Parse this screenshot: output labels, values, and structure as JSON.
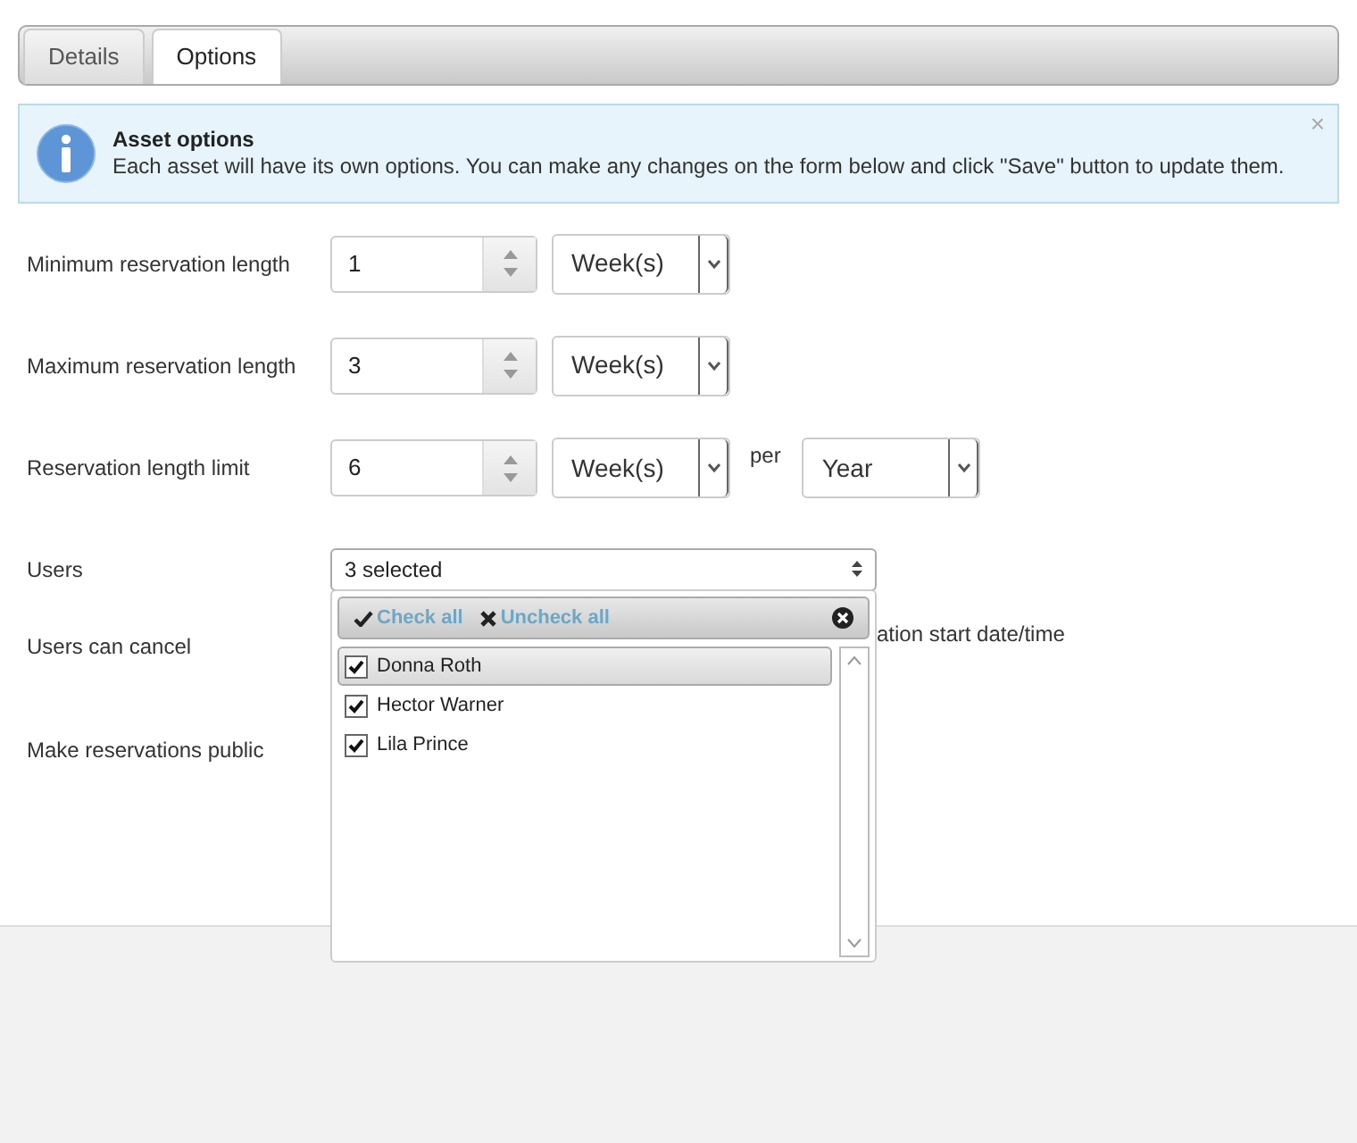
{
  "tabs": [
    {
      "label": "Details",
      "selected": false
    },
    {
      "label": "Options",
      "selected": true
    }
  ],
  "alert": {
    "title": "Asset options",
    "text": "Each asset will have its own options. You can make any changes on the form below and click \"Save\" button to update them.",
    "close": "×"
  },
  "rows": [
    {
      "kind": "spinner",
      "label": "Minimum reservation length",
      "value": "1",
      "unit": "Week(s)"
    },
    {
      "kind": "spinner",
      "label": "Maximum reservation length",
      "value": "3",
      "unit": "Week(s)"
    },
    {
      "kind": "spinner",
      "label": "Reservation length limit",
      "value": "6",
      "unit": "Week(s)",
      "per": "per",
      "period": "Year"
    },
    {
      "kind": "multiselect",
      "label": "Users",
      "value": "3 selected"
    },
    {
      "kind": "text",
      "label": "Users can cancel",
      "text": "ation start date/time"
    },
    {
      "kind": "plain",
      "label": "Make reservations public"
    }
  ],
  "dropdown": {
    "check_all": "Check all",
    "uncheck_all": "Uncheck all",
    "options": [
      {
        "label": "Donna Roth",
        "checked": true,
        "selected": true
      },
      {
        "label": "Hector Warner",
        "checked": true,
        "selected": false
      },
      {
        "label": "Lila Prince",
        "checked": true,
        "selected": false
      }
    ]
  }
}
